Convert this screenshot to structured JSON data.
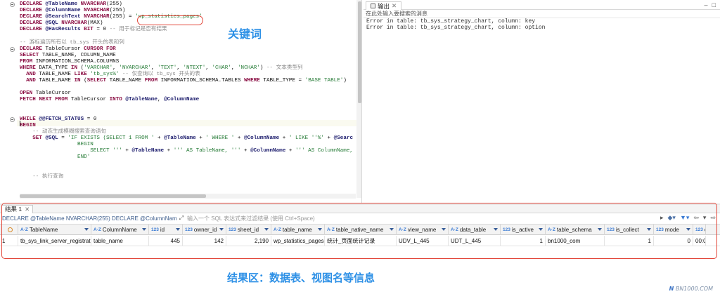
{
  "editor": {
    "lines": [
      [
        [
          "kw",
          "DECLARE "
        ],
        [
          "vr",
          "@TableName "
        ],
        [
          "kw",
          "NVARCHAR"
        ],
        [
          "fn",
          "(255)"
        ]
      ],
      [
        [
          "kw",
          "DECLARE "
        ],
        [
          "vr",
          "@ColumnName "
        ],
        [
          "kw",
          "NVARCHAR"
        ],
        [
          "fn",
          "(255)"
        ]
      ],
      [
        [
          "kw",
          "DECLARE "
        ],
        [
          "vr",
          "@SearchText "
        ],
        [
          "kw",
          "NVARCHAR"
        ],
        [
          "fn",
          "(255) = "
        ],
        [
          "st",
          "'wp_statistics_pages'"
        ]
      ],
      [
        [
          "kw",
          "DECLARE "
        ],
        [
          "vr",
          "@SQL "
        ],
        [
          "kw",
          "NVARCHAR"
        ],
        [
          "fn",
          "(MAX)"
        ]
      ],
      [
        [
          "kw",
          "DECLARE "
        ],
        [
          "vr",
          "@HasResults "
        ],
        [
          "kw",
          "BIT"
        ],
        [
          "fn",
          " = 0 "
        ],
        [
          "cm",
          "-- 用于标记是否有结果"
        ]
      ],
      [
        [
          "fn",
          ""
        ]
      ],
      [
        [
          "cm",
          "-- 游标遍历所有以 tb_sys 开头的表和列"
        ]
      ],
      [
        [
          "kw",
          "DECLARE "
        ],
        [
          "fn",
          "TableCursor "
        ],
        [
          "kw",
          "CURSOR FOR"
        ]
      ],
      [
        [
          "kw",
          "SELECT "
        ],
        [
          "fn",
          "TABLE_NAME, COLUMN_NAME"
        ]
      ],
      [
        [
          "kw",
          "FROM "
        ],
        [
          "fn",
          "INFORMATION_SCHEMA.COLUMNS"
        ]
      ],
      [
        [
          "kw",
          "WHERE "
        ],
        [
          "fn",
          "DATA_TYPE "
        ],
        [
          "kw",
          "IN "
        ],
        [
          "fn",
          "("
        ],
        [
          "st",
          "'VARCHAR'"
        ],
        [
          "fn",
          ", "
        ],
        [
          "st",
          "'NVARCHAR'"
        ],
        [
          "fn",
          ", "
        ],
        [
          "st",
          "'TEXT'"
        ],
        [
          "fn",
          ", "
        ],
        [
          "st",
          "'NTEXT'"
        ],
        [
          "fn",
          ", "
        ],
        [
          "st",
          "'CHAR'"
        ],
        [
          "fn",
          ", "
        ],
        [
          "st",
          "'NCHAR'"
        ],
        [
          "fn",
          ") "
        ],
        [
          "cm",
          "-- 文本类型列"
        ]
      ],
      [
        [
          "fn",
          "  "
        ],
        [
          "kw",
          "AND "
        ],
        [
          "fn",
          "TABLE_NAME "
        ],
        [
          "kw",
          "LIKE "
        ],
        [
          "st",
          "'tb_sys%'"
        ],
        [
          "cm",
          " -- 仅查询以 tb_sys 开头的表"
        ]
      ],
      [
        [
          "fn",
          "  "
        ],
        [
          "kw",
          "AND "
        ],
        [
          "fn",
          "TABLE_NAME "
        ],
        [
          "kw",
          "IN "
        ],
        [
          "fn",
          "("
        ],
        [
          "kw",
          "SELECT "
        ],
        [
          "fn",
          "TABLE_NAME "
        ],
        [
          "kw",
          "FROM "
        ],
        [
          "fn",
          "INFORMATION_SCHEMA.TABLES "
        ],
        [
          "kw",
          "WHERE "
        ],
        [
          "fn",
          "TABLE_TYPE = "
        ],
        [
          "st",
          "'BASE TABLE'"
        ],
        [
          "fn",
          ")"
        ]
      ],
      [
        [
          "fn",
          ""
        ]
      ],
      [
        [
          "kw",
          "OPEN "
        ],
        [
          "fn",
          "TableCursor"
        ]
      ],
      [
        [
          "kw",
          "FETCH NEXT FROM "
        ],
        [
          "fn",
          "TableCursor "
        ],
        [
          "kw",
          "INTO "
        ],
        [
          "vr",
          "@TableName"
        ],
        [
          "fn",
          ", "
        ],
        [
          "vr",
          "@ColumnName"
        ]
      ],
      [
        [
          "fn",
          ""
        ]
      ],
      [
        [
          "fn",
          ""
        ]
      ],
      [
        [
          "kw",
          "WHILE "
        ],
        [
          "vr",
          "@@FETCH_STATUS"
        ],
        [
          "fn",
          " = 0"
        ]
      ],
      [
        [
          "kw",
          "BEGIN"
        ]
      ],
      [
        [
          "cm",
          "    -- 动态生成模糊搜索查询语句"
        ]
      ],
      [
        [
          "fn",
          "    "
        ],
        [
          "kw",
          "SET "
        ],
        [
          "vr",
          "@SQL"
        ],
        [
          "fn",
          " = "
        ],
        [
          "st",
          "'IF EXISTS (SELECT 1 FROM '"
        ],
        [
          "fn",
          " + "
        ],
        [
          "vr",
          "@TableName"
        ],
        [
          "fn",
          " + "
        ],
        [
          "st",
          "' WHERE '"
        ],
        [
          "fn",
          " + "
        ],
        [
          "vr",
          "@ColumnName"
        ],
        [
          "fn",
          " + "
        ],
        [
          "st",
          "' LIKE ''%'"
        ],
        [
          "fn",
          " + "
        ],
        [
          "vr",
          "@Searc"
        ]
      ],
      [
        [
          "st",
          "                  BEGIN"
        ]
      ],
      [
        [
          "st",
          "                      SELECT '''"
        ],
        [
          "fn",
          " + "
        ],
        [
          "vr",
          "@TableName"
        ],
        [
          "fn",
          " + "
        ],
        [
          "st",
          "''' AS TableName, '''"
        ],
        [
          "fn",
          " + "
        ],
        [
          "vr",
          "@ColumnName"
        ],
        [
          "fn",
          " + "
        ],
        [
          "st",
          "''' AS ColumnName, '"
        ]
      ],
      [
        [
          "st",
          "                  END'"
        ]
      ],
      [
        [
          "fn",
          ""
        ]
      ],
      [
        [
          "fn",
          ""
        ]
      ],
      [
        [
          "cm",
          "    -- 执行查询"
        ]
      ]
    ],
    "folds": [
      0,
      7,
      18
    ]
  },
  "annotations": {
    "keyword_label": "关键词",
    "result_label": "结果区：数据表、视图名等信息"
  },
  "output": {
    "tab_label": "输出",
    "filter_placeholder": "在此处输入要搜索的消息",
    "messages": [
      "Error in table: tb_sys_strategy_chart, column: key",
      "Error in table: tb_sys_strategy_chart, column: option"
    ]
  },
  "results": {
    "tab_label": "结果 1",
    "query_text": "DECLARE @TableName NVARCHAR(255) DECLARE @ColumnName NVARC",
    "filter_placeholder": "输入一个 SQL 表达式来过滤结果 (使用 Ctrl+Space)",
    "columns": [
      {
        "type": "A·Z",
        "name": "TableName"
      },
      {
        "type": "A·Z",
        "name": "ColumnName"
      },
      {
        "type": "123",
        "name": "id"
      },
      {
        "type": "123",
        "name": "owner_id"
      },
      {
        "type": "123",
        "name": "sheet_id"
      },
      {
        "type": "A·Z",
        "name": "table_name"
      },
      {
        "type": "A·Z",
        "name": "table_native_name"
      },
      {
        "type": "A·Z",
        "name": "view_name"
      },
      {
        "type": "A·Z",
        "name": "data_table"
      },
      {
        "type": "123",
        "name": "is_active"
      },
      {
        "type": "A·Z",
        "name": "table_schema"
      },
      {
        "type": "123",
        "name": "is_collect"
      },
      {
        "type": "123",
        "name": "mode"
      },
      {
        "type": "123",
        "name": "c"
      }
    ],
    "row": {
      "index": "1",
      "cells": [
        "tb_sys_link_server_registration",
        "table_name",
        "445",
        "142",
        "2,190",
        "wp_statistics_pages",
        "统计_页面统计记录",
        "UDV_L_445",
        "UDT_L_445",
        "1",
        "bn1000_com",
        "1",
        "0",
        "00:0"
      ]
    }
  },
  "watermark": {
    "brand": "BN1000.COM"
  }
}
